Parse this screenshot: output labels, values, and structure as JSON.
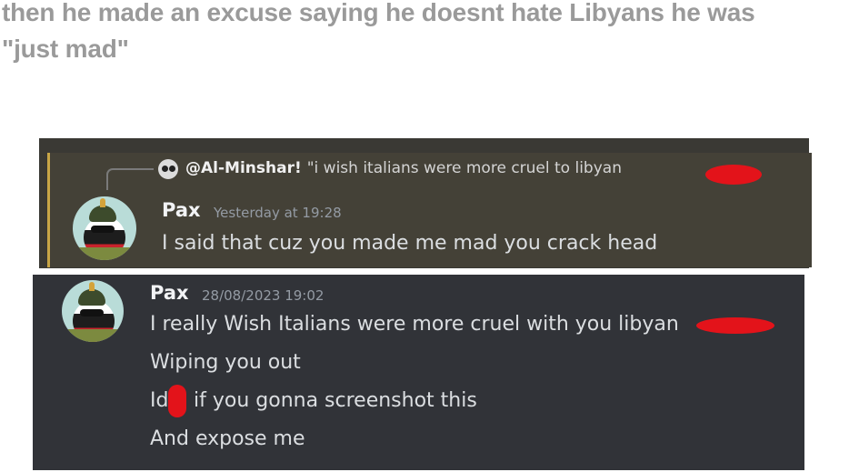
{
  "caption": {
    "line1": "then he made an excuse saying he doesnt hate Libyans he was",
    "line2": "\"just mad\""
  },
  "screenshot_one": {
    "reply": {
      "mention": "@Al-Minshar!",
      "text": "\"i wish italians were more cruel to libyan"
    },
    "author": "Pax",
    "timestamp": "Yesterday at 19:28",
    "message": "I said that cuz you made me mad you crack head"
  },
  "screenshot_two": {
    "author": "Pax",
    "timestamp": "28/08/2023 19:02",
    "messages": [
      "I really Wish Italians were more cruel with you libyan",
      "Wiping you out",
      "Id",
      "if you gonna screenshot this",
      "And expose me"
    ]
  },
  "colors": {
    "redaction": "#e3131a",
    "reply_highlight_border": "#c8a646"
  }
}
